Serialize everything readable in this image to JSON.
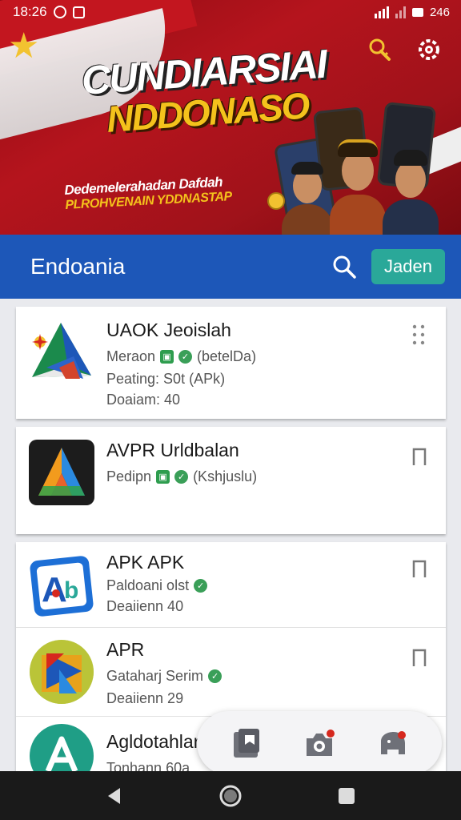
{
  "status_bar": {
    "time": "18:26",
    "battery_text": "246"
  },
  "banner": {
    "title_line1": "CUNDIARSIAI",
    "title_line2": "NDDONASO",
    "subtitle_line1": "Dedemelerahadan Dafdah",
    "subtitle_line2": "PLROHVENAIN YDDNASTAP"
  },
  "appbar": {
    "title": "Endoania",
    "join_label": "Jaden"
  },
  "apps": [
    {
      "name": "UAOK Jeoislah",
      "line1": "Meraon",
      "line1_tail": "(betelDa)",
      "line2": "Peating: S0t (APk)",
      "line3": "Doaiam: 40"
    },
    {
      "name": "AVPR Urldbalan",
      "line1": "Pedipn",
      "line1_tail": "(Kshjuslu)"
    },
    {
      "name": "APK APK",
      "line1": "Paldoani olst",
      "line2": "Deaiienn 40"
    },
    {
      "name": "APR",
      "line1": "Gataharj Serim",
      "line2": "Deaiienn 29"
    },
    {
      "name": "Agldotahlar",
      "line1": "Tonhann 60a"
    }
  ],
  "icons": {
    "search": "search-icon",
    "settings": "settings-icon",
    "more": "more-vert-icon",
    "bookmark": "bookmark-icon"
  },
  "colors": {
    "appbar": "#1d57b8",
    "join": "#2aa899",
    "banner": "#b5141d",
    "accent_yellow": "#f4c21c"
  }
}
